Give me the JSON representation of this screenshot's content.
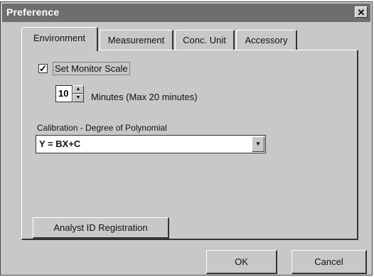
{
  "window": {
    "title": "Preference",
    "close_glyph": "✕"
  },
  "tabs": [
    {
      "label": "Environment",
      "active": true
    },
    {
      "label": "Measurement",
      "active": false
    },
    {
      "label": "Conc. Unit",
      "active": false
    },
    {
      "label": "Accessory",
      "active": false
    }
  ],
  "monitor": {
    "checked": true,
    "check_glyph": "✓",
    "label": "Set Monitor Scale",
    "value": "10",
    "units_label": "Minutes (Max 20 minutes)",
    "spin_up_glyph": "▲",
    "spin_down_glyph": "▼"
  },
  "calibration": {
    "label": "Calibration - Degree of Polynomial",
    "selected": "Y = BX+C",
    "arrow_glyph": "▼"
  },
  "buttons": {
    "analyst": "Analyst ID Registration",
    "ok": "OK",
    "cancel": "Cancel"
  },
  "colors": {
    "dialog_bg": "#c8c8c8",
    "titlebar_bg": "#6e6e6e"
  }
}
